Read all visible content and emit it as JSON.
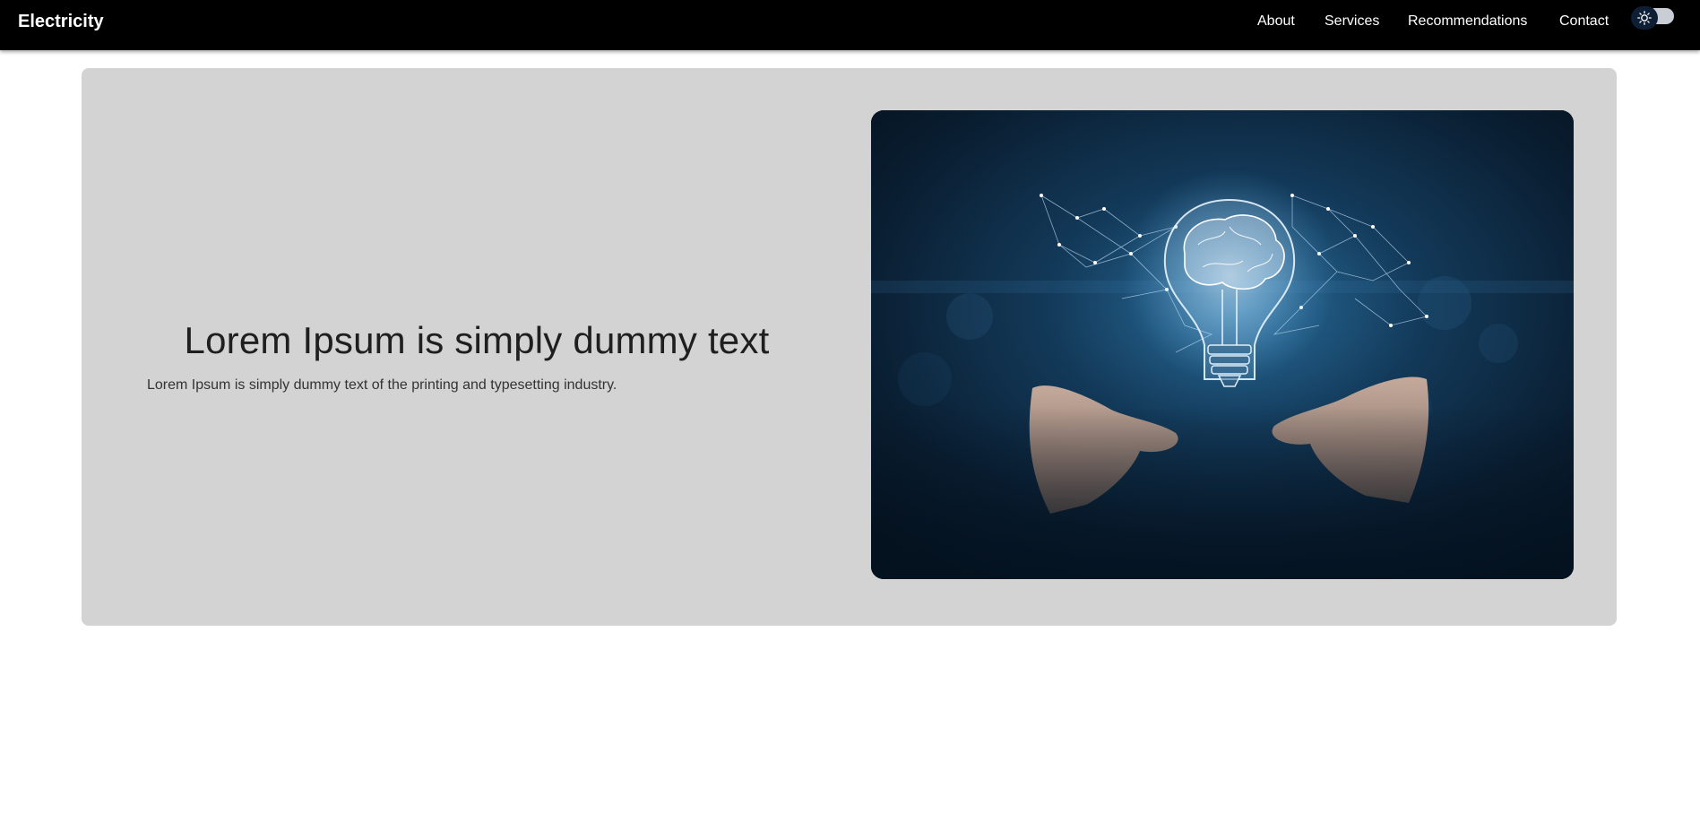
{
  "navbar": {
    "brand": "Electricity",
    "links": [
      {
        "label": "About"
      },
      {
        "label": "Services"
      },
      {
        "label": "Recommendations"
      },
      {
        "label": "Contact"
      }
    ],
    "theme_toggle": {
      "icon": "sun-icon",
      "state": "light"
    }
  },
  "hero": {
    "title": "Lorem Ipsum is simply dummy text",
    "text": "Lorem Ipsum is simply dummy text of the printing and typesetting industry.",
    "image": {
      "subject": "glowing-lightbulb-brain-hands-photo"
    }
  },
  "colors": {
    "navbar_bg": "#000000",
    "hero_bg": "#d3d3d3",
    "page_bg": "#ffffff"
  }
}
